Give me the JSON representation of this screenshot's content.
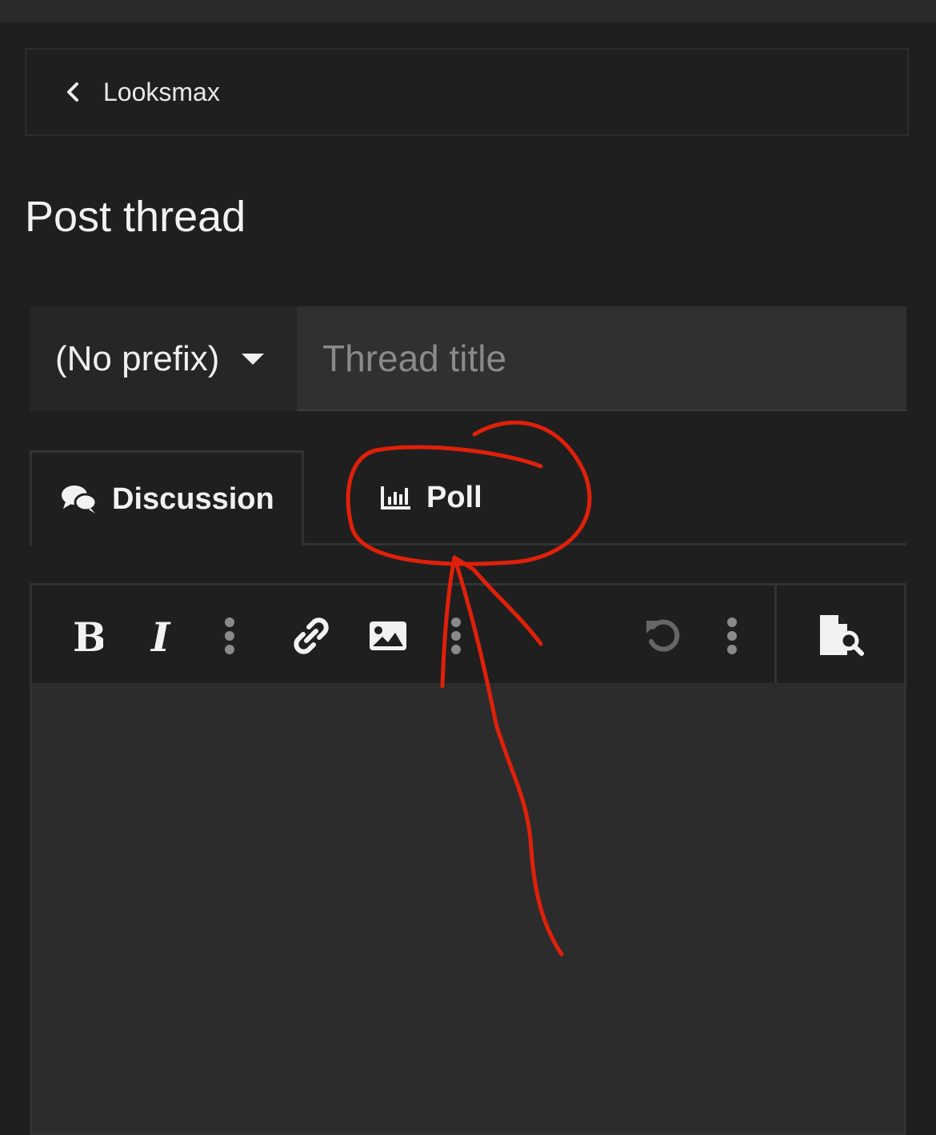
{
  "breadcrumb": {
    "label": "Looksmax"
  },
  "page": {
    "title": "Post thread"
  },
  "form": {
    "prefix_value": "(No prefix)",
    "title_placeholder": "Thread title",
    "title_value": ""
  },
  "tabs": [
    {
      "label": "Discussion",
      "icon": "comments-icon",
      "active": true
    },
    {
      "label": "Poll",
      "icon": "poll-chart-icon",
      "active": false
    }
  ],
  "toolbar": {
    "tools": [
      "bold-icon",
      "italic-icon",
      "more-options-icon",
      "link-icon",
      "image-icon",
      "more-options-icon",
      "undo-icon",
      "more-options-icon",
      "preview-icon"
    ]
  },
  "colors": {
    "background": "#1f1f1f",
    "annotation": "#e0200a"
  }
}
